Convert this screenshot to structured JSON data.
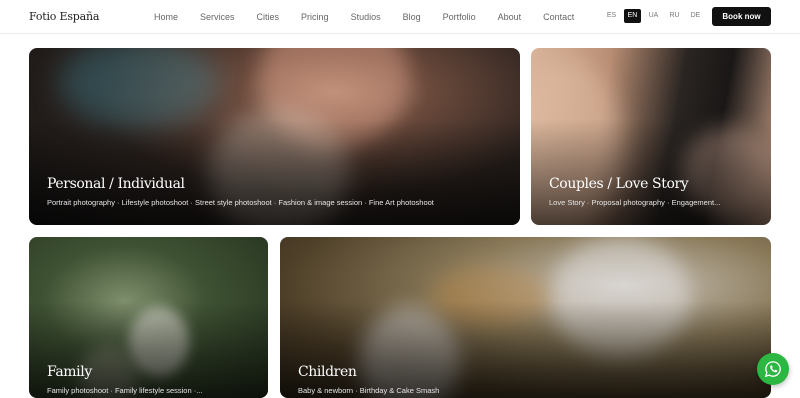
{
  "header": {
    "logo": "Fotio España",
    "nav": [
      "Home",
      "Services",
      "Cities",
      "Pricing",
      "Studios",
      "Blog",
      "Portfolio",
      "About",
      "Contact"
    ],
    "languages": [
      "ES",
      "EN",
      "UA",
      "RU",
      "DE"
    ],
    "active_language": "EN",
    "book_label": "Book now"
  },
  "cards": {
    "personal": {
      "title": "Personal / Individual",
      "subtitle": "Portrait photography · Lifestyle photoshoot · Street style photoshoot · Fashion & image session · Fine Art photoshoot"
    },
    "couples": {
      "title": "Couples / Love Story",
      "subtitle": "Love Story · Proposal photography · Engagement..."
    },
    "family": {
      "title": "Family",
      "subtitle": "Family photoshoot · Family lifestyle session ·..."
    },
    "children": {
      "title": "Children",
      "subtitle": "Baby & newborn · Birthday & Cake Smash"
    }
  },
  "whatsapp_icon": "whatsapp-icon",
  "colors": {
    "accent": "#111111",
    "whatsapp": "#2bb741"
  }
}
